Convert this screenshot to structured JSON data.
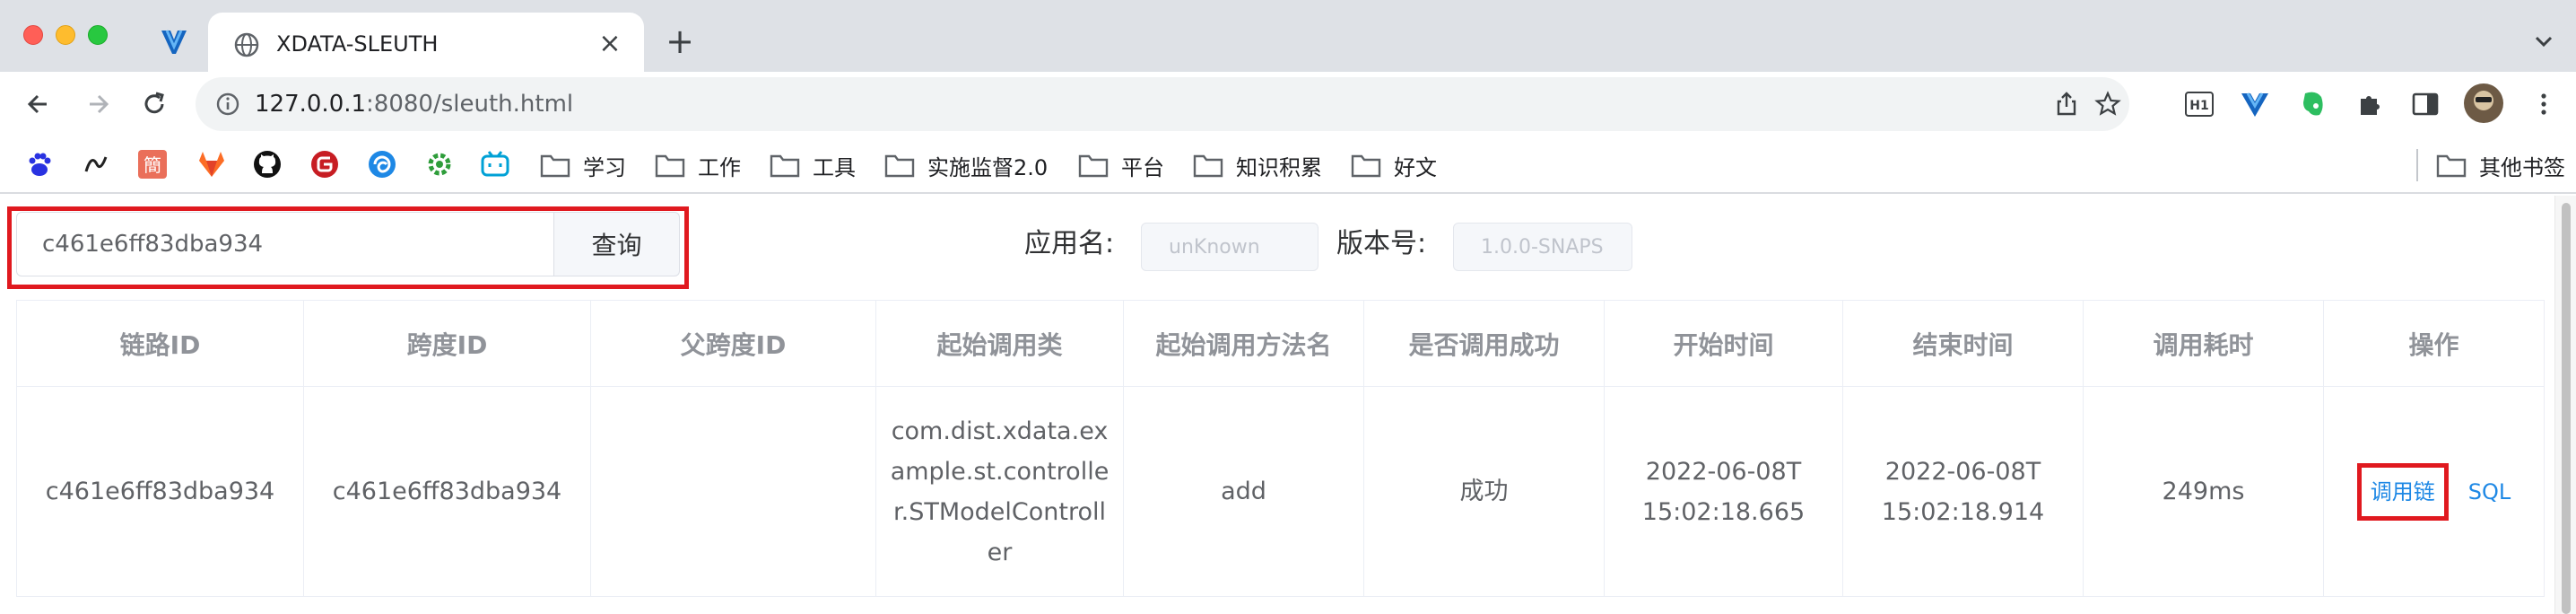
{
  "browser": {
    "tab_title": "XDATA-SLEUTH",
    "url_host": "127.0.0.1",
    "url_rest": ":8080/sleuth.html",
    "accent": "#1a73e8"
  },
  "bookmarks": [
    {
      "label": "学习"
    },
    {
      "label": "工作"
    },
    {
      "label": "工具"
    },
    {
      "label": "实施监督2.0"
    },
    {
      "label": "平台"
    },
    {
      "label": "知识积累"
    },
    {
      "label": "好文"
    }
  ],
  "bookmarks_other": "其他书签",
  "search": {
    "value": "c461e6ff83dba934",
    "button_label": "查询"
  },
  "app_label": "应用名:",
  "app_value": "unKnown",
  "version_label": "版本号:",
  "version_value": "1.0.0-SNAPS",
  "table": {
    "headers": [
      "链路ID",
      "跨度ID",
      "父跨度ID",
      "起始调用类",
      "起始调用方法名",
      "是否调用成功",
      "开始时间",
      "结束时间",
      "调用耗时",
      "操作"
    ],
    "row": {
      "trace_id": "c461e6ff83dba934",
      "span_id": "c461e6ff83dba934",
      "parent_span_id": "",
      "class_name": "com.dist.xdata.example.st.controller.STModelController",
      "method": "add",
      "success": "成功",
      "start_time": "2022-06-08T15:02:18.665",
      "end_time": "2022-06-08T15:02:18.914",
      "duration": "249ms",
      "action_chain": "调用链",
      "action_sql": "SQL"
    }
  },
  "highlight_color": "#e0191f",
  "link_color": "#1e88e5"
}
